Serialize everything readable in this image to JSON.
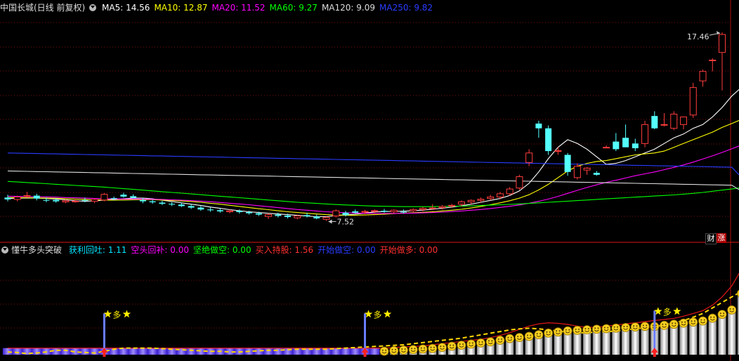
{
  "main_header": {
    "title": "中国长城(日线 前复权)",
    "ma": [
      {
        "label": "MA5: 14.56",
        "color": "#ffffff"
      },
      {
        "label": "MA10: 12.87",
        "color": "#ffff00"
      },
      {
        "label": "MA20: 11.52",
        "color": "#ff00ff"
      },
      {
        "label": "MA60: 9.27",
        "color": "#00ff00"
      },
      {
        "label": "MA120: 9.09",
        "color": "#dddddd"
      },
      {
        "label": "MA250: 9.82",
        "color": "#2a3cff"
      }
    ]
  },
  "badges": {
    "cai": "财",
    "zhang": "涨"
  },
  "indicator_header": {
    "title": "懂牛多头突破",
    "items": [
      {
        "label": "获利回吐: 1.11",
        "color": "#00e5ff"
      },
      {
        "label": "空头回补: 0.00",
        "color": "#ff00ff"
      },
      {
        "label": "坚绝做空: 0.00",
        "color": "#00ff00"
      },
      {
        "label": "买入持股: 1.56",
        "color": "#ff3030"
      },
      {
        "label": "开始做空: 0.00",
        "color": "#2a3cff"
      },
      {
        "label": "开始做多: 0.00",
        "color": "#ff3030"
      }
    ]
  },
  "chart_data": {
    "type": "candlestick",
    "price_ylim": [
      6.5,
      18.5
    ],
    "annotations": {
      "high": "17.46",
      "low": "7.52",
      "signal": "多"
    },
    "candles": [
      {
        "o": 8.75,
        "h": 8.9,
        "l": 8.55,
        "c": 8.65
      },
      {
        "o": 8.65,
        "h": 8.85,
        "l": 8.55,
        "c": 8.78
      },
      {
        "o": 8.85,
        "h": 9.05,
        "l": 8.75,
        "c": 8.85
      },
      {
        "o": 8.85,
        "h": 8.95,
        "l": 8.6,
        "c": 8.7
      },
      {
        "o": 8.62,
        "h": 8.75,
        "l": 8.5,
        "c": 8.6
      },
      {
        "o": 8.62,
        "h": 8.72,
        "l": 8.48,
        "c": 8.55
      },
      {
        "o": 8.52,
        "h": 8.65,
        "l": 8.45,
        "c": 8.58
      },
      {
        "o": 8.55,
        "h": 8.68,
        "l": 8.48,
        "c": 8.56
      },
      {
        "o": 8.62,
        "h": 8.75,
        "l": 8.5,
        "c": 8.6
      },
      {
        "o": 8.55,
        "h": 8.7,
        "l": 8.45,
        "c": 8.65
      },
      {
        "o": 8.62,
        "h": 8.98,
        "l": 8.55,
        "c": 8.92
      },
      {
        "o": 8.72,
        "h": 8.8,
        "l": 8.6,
        "c": 8.68
      },
      {
        "o": 8.9,
        "h": 9.0,
        "l": 8.75,
        "c": 8.8
      },
      {
        "o": 8.82,
        "h": 8.92,
        "l": 8.7,
        "c": 8.74
      },
      {
        "o": 8.62,
        "h": 8.72,
        "l": 8.45,
        "c": 8.55
      },
      {
        "o": 8.55,
        "h": 8.65,
        "l": 8.42,
        "c": 8.5
      },
      {
        "o": 8.48,
        "h": 8.58,
        "l": 8.35,
        "c": 8.42
      },
      {
        "o": 8.42,
        "h": 8.5,
        "l": 8.3,
        "c": 8.38
      },
      {
        "o": 8.38,
        "h": 8.48,
        "l": 8.25,
        "c": 8.3
      },
      {
        "o": 8.3,
        "h": 8.38,
        "l": 8.15,
        "c": 8.22
      },
      {
        "o": 8.22,
        "h": 8.3,
        "l": 8.05,
        "c": 8.12
      },
      {
        "o": 8.12,
        "h": 8.22,
        "l": 8.0,
        "c": 8.08
      },
      {
        "o": 8.08,
        "h": 8.18,
        "l": 7.95,
        "c": 8.02
      },
      {
        "o": 8.0,
        "h": 8.12,
        "l": 7.92,
        "c": 8.05
      },
      {
        "o": 8.05,
        "h": 8.12,
        "l": 7.9,
        "c": 7.98
      },
      {
        "o": 7.98,
        "h": 8.05,
        "l": 7.85,
        "c": 7.92
      },
      {
        "o": 7.92,
        "h": 8.0,
        "l": 7.78,
        "c": 7.85
      },
      {
        "o": 7.75,
        "h": 7.92,
        "l": 7.62,
        "c": 7.85
      },
      {
        "o": 7.85,
        "h": 7.95,
        "l": 7.7,
        "c": 7.78
      },
      {
        "o": 7.8,
        "h": 7.9,
        "l": 7.65,
        "c": 7.72
      },
      {
        "o": 7.68,
        "h": 7.85,
        "l": 7.6,
        "c": 7.78
      },
      {
        "o": 7.82,
        "h": 7.95,
        "l": 7.7,
        "c": 7.76
      },
      {
        "o": 7.75,
        "h": 7.85,
        "l": 7.6,
        "c": 7.65
      },
      {
        "o": 7.6,
        "h": 7.75,
        "l": 7.52,
        "c": 7.7
      },
      {
        "o": 7.78,
        "h": 8.12,
        "l": 7.7,
        "c": 8.05
      },
      {
        "o": 7.95,
        "h": 8.05,
        "l": 7.75,
        "c": 7.82
      },
      {
        "o": 8.02,
        "h": 8.12,
        "l": 7.9,
        "c": 7.95
      },
      {
        "o": 7.98,
        "h": 8.1,
        "l": 7.88,
        "c": 8.02
      },
      {
        "o": 8.02,
        "h": 8.12,
        "l": 7.92,
        "c": 8.06
      },
      {
        "o": 8.05,
        "h": 8.15,
        "l": 7.95,
        "c": 8.0
      },
      {
        "o": 8.0,
        "h": 8.12,
        "l": 7.92,
        "c": 8.08
      },
      {
        "o": 8.0,
        "h": 8.12,
        "l": 7.9,
        "c": 7.96
      },
      {
        "o": 8.05,
        "h": 8.18,
        "l": 7.98,
        "c": 8.12
      },
      {
        "o": 8.12,
        "h": 8.25,
        "l": 8.02,
        "c": 8.18
      },
      {
        "o": 8.2,
        "h": 8.4,
        "l": 8.12,
        "c": 8.2
      },
      {
        "o": 8.22,
        "h": 8.35,
        "l": 8.12,
        "c": 8.28
      },
      {
        "o": 8.3,
        "h": 8.42,
        "l": 8.2,
        "c": 8.34
      },
      {
        "o": 8.4,
        "h": 8.6,
        "l": 8.28,
        "c": 8.52
      },
      {
        "o": 8.52,
        "h": 8.65,
        "l": 8.4,
        "c": 8.6
      },
      {
        "o": 8.6,
        "h": 8.75,
        "l": 8.5,
        "c": 8.66
      },
      {
        "o": 8.7,
        "h": 8.9,
        "l": 8.6,
        "c": 8.78
      },
      {
        "o": 8.78,
        "h": 9.05,
        "l": 8.65,
        "c": 8.95
      },
      {
        "o": 8.95,
        "h": 9.3,
        "l": 8.85,
        "c": 9.2
      },
      {
        "o": 9.25,
        "h": 9.95,
        "l": 9.15,
        "c": 9.85
      },
      {
        "o": 10.6,
        "h": 11.3,
        "l": 10.4,
        "c": 11.1
      },
      {
        "o": 12.65,
        "h": 12.8,
        "l": 11.9,
        "c": 12.4
      },
      {
        "o": 12.4,
        "h": 12.55,
        "l": 11.0,
        "c": 11.2
      },
      {
        "o": 11.2,
        "h": 11.4,
        "l": 11.0,
        "c": 11.22
      },
      {
        "o": 11.0,
        "h": 11.1,
        "l": 9.9,
        "c": 10.1
      },
      {
        "o": 9.8,
        "h": 10.55,
        "l": 9.7,
        "c": 10.4
      },
      {
        "o": 10.2,
        "h": 10.35,
        "l": 9.95,
        "c": 10.3
      },
      {
        "o": 10.05,
        "h": 10.15,
        "l": 9.9,
        "c": 9.95
      },
      {
        "o": 11.4,
        "h": 11.5,
        "l": 11.35,
        "c": 11.4
      },
      {
        "o": 11.7,
        "h": 12.15,
        "l": 11.2,
        "c": 11.3
      },
      {
        "o": 11.9,
        "h": 12.6,
        "l": 11.4,
        "c": 11.4
      },
      {
        "o": 11.6,
        "h": 11.85,
        "l": 11.2,
        "c": 11.35
      },
      {
        "o": 11.6,
        "h": 12.8,
        "l": 11.4,
        "c": 12.6
      },
      {
        "o": 13.05,
        "h": 13.3,
        "l": 12.35,
        "c": 12.4
      },
      {
        "o": 12.6,
        "h": 13.2,
        "l": 12.5,
        "c": 12.6
      },
      {
        "o": 12.4,
        "h": 13.3,
        "l": 12.3,
        "c": 13.15
      },
      {
        "o": 12.6,
        "h": 13.0,
        "l": 12.35,
        "c": 13.0
      },
      {
        "o": 13.1,
        "h": 14.8,
        "l": 12.95,
        "c": 14.55
      },
      {
        "o": 14.9,
        "h": 15.5,
        "l": 14.6,
        "c": 15.4
      },
      {
        "o": 16.0,
        "h": 16.1,
        "l": 15.4,
        "c": 16.0
      },
      {
        "o": 16.4,
        "h": 17.46,
        "l": 14.4,
        "c": 17.35
      }
    ],
    "ma_lines": [
      {
        "name": "MA5",
        "color": "#ffffff",
        "values": [
          8.7,
          8.72,
          8.73,
          8.72,
          8.7,
          8.67,
          8.63,
          8.58,
          8.55,
          8.57,
          8.62,
          8.65,
          8.68,
          8.72,
          8.72,
          8.68,
          8.61,
          8.54,
          8.47,
          8.4,
          8.33,
          8.25,
          8.18,
          8.11,
          8.05,
          8.0,
          7.96,
          7.92,
          7.88,
          7.85,
          7.81,
          7.77,
          7.74,
          7.74,
          7.8,
          7.83,
          7.87,
          7.93,
          7.99,
          8.01,
          8.02,
          8.03,
          8.05,
          8.09,
          8.13,
          8.19,
          8.24,
          8.32,
          8.4,
          8.5,
          8.6,
          8.7,
          8.86,
          9.1,
          9.5,
          10.1,
          10.8,
          11.4,
          11.8,
          11.6,
          11.3,
          10.9,
          10.5,
          10.55,
          10.7,
          10.9,
          11.1,
          11.3,
          11.6,
          11.9,
          12.1,
          12.4,
          12.6,
          13.0,
          13.5,
          14.1,
          14.56
        ]
      },
      {
        "name": "MA10",
        "color": "#ffff00",
        "values": [
          8.75,
          8.75,
          8.74,
          8.73,
          8.72,
          8.71,
          8.69,
          8.67,
          8.65,
          8.63,
          8.62,
          8.61,
          8.62,
          8.63,
          8.64,
          8.64,
          8.62,
          8.6,
          8.57,
          8.54,
          8.5,
          8.45,
          8.4,
          8.34,
          8.28,
          8.22,
          8.16,
          8.11,
          8.05,
          8.0,
          7.96,
          7.92,
          7.88,
          7.85,
          7.83,
          7.82,
          7.82,
          7.83,
          7.85,
          7.87,
          7.9,
          7.93,
          7.95,
          7.97,
          8.0,
          8.04,
          8.08,
          8.13,
          8.2,
          8.28,
          8.37,
          8.47,
          8.58,
          8.72,
          8.9,
          9.15,
          9.45,
          9.8,
          10.15,
          10.4,
          10.55,
          10.65,
          10.7,
          10.8,
          10.9,
          11.0,
          11.05,
          11.1,
          11.2,
          11.4,
          11.6,
          11.8,
          12.0,
          12.2,
          12.45,
          12.65,
          12.87
        ]
      },
      {
        "name": "MA20",
        "color": "#ff00ff",
        "values": [
          8.82,
          8.81,
          8.8,
          8.79,
          8.78,
          8.77,
          8.75,
          8.74,
          8.72,
          8.7,
          8.69,
          8.68,
          8.67,
          8.67,
          8.67,
          8.66,
          8.65,
          8.63,
          8.61,
          8.59,
          8.56,
          8.53,
          8.49,
          8.45,
          8.41,
          8.37,
          8.32,
          8.27,
          8.22,
          8.17,
          8.12,
          8.08,
          8.04,
          8.0,
          7.97,
          7.95,
          7.93,
          7.92,
          7.91,
          7.91,
          7.91,
          7.92,
          7.93,
          7.94,
          7.96,
          7.98,
          8.01,
          8.04,
          8.08,
          8.12,
          8.17,
          8.23,
          8.29,
          8.36,
          8.45,
          8.55,
          8.67,
          8.81,
          8.97,
          9.13,
          9.28,
          9.42,
          9.55,
          9.66,
          9.78,
          9.9,
          10.0,
          10.1,
          10.22,
          10.34,
          10.47,
          10.62,
          10.78,
          10.95,
          11.13,
          11.32,
          11.52
        ]
      },
      {
        "name": "MA60",
        "color": "#00ff00",
        "values": [
          9.6,
          9.57,
          9.54,
          9.51,
          9.48,
          9.45,
          9.42,
          9.39,
          9.36,
          9.33,
          9.3,
          9.26,
          9.22,
          9.18,
          9.14,
          9.1,
          9.06,
          9.02,
          8.98,
          8.94,
          8.9,
          8.86,
          8.82,
          8.78,
          8.74,
          8.7,
          8.66,
          8.62,
          8.58,
          8.54,
          8.5,
          8.47,
          8.44,
          8.41,
          8.38,
          8.36,
          8.34,
          8.32,
          8.3,
          8.29,
          8.28,
          8.27,
          8.27,
          8.27,
          8.27,
          8.28,
          8.29,
          8.3,
          8.31,
          8.33,
          8.35,
          8.37,
          8.39,
          8.41,
          8.44,
          8.47,
          8.5,
          8.53,
          8.56,
          8.59,
          8.62,
          8.65,
          8.68,
          8.71,
          8.74,
          8.77,
          8.8,
          8.83,
          8.86,
          8.89,
          8.93,
          8.97,
          9.02,
          9.08,
          9.14,
          9.2,
          9.27
        ]
      },
      {
        "name": "MA120",
        "color": "#dddddd",
        "values": [
          10.15,
          10.14,
          10.13,
          10.12,
          10.11,
          10.1,
          10.09,
          10.08,
          10.07,
          10.06,
          10.05,
          10.04,
          10.03,
          10.02,
          10.01,
          10.0,
          9.99,
          9.98,
          9.97,
          9.96,
          9.95,
          9.94,
          9.93,
          9.92,
          9.91,
          9.9,
          9.89,
          9.88,
          9.87,
          9.86,
          9.85,
          9.84,
          9.83,
          9.82,
          9.81,
          9.8,
          9.79,
          9.78,
          9.77,
          9.76,
          9.75,
          9.74,
          9.73,
          9.72,
          9.71,
          9.7,
          9.69,
          9.68,
          9.67,
          9.66,
          9.65,
          9.64,
          9.63,
          9.62,
          9.61,
          9.6,
          9.59,
          9.58,
          9.57,
          9.56,
          9.55,
          9.54,
          9.53,
          9.52,
          9.51,
          9.5,
          9.49,
          9.48,
          9.47,
          9.46,
          9.45,
          9.44,
          9.43,
          9.42,
          9.41,
          9.4,
          9.09
        ]
      },
      {
        "name": "MA250",
        "color": "#2a3cff",
        "values": [
          11.1,
          11.09,
          11.08,
          11.07,
          11.06,
          11.05,
          11.04,
          11.03,
          11.02,
          11.01,
          11.0,
          10.99,
          10.98,
          10.97,
          10.96,
          10.95,
          10.94,
          10.93,
          10.92,
          10.91,
          10.9,
          10.89,
          10.88,
          10.87,
          10.86,
          10.85,
          10.84,
          10.83,
          10.82,
          10.81,
          10.8,
          10.79,
          10.78,
          10.77,
          10.76,
          10.75,
          10.74,
          10.73,
          10.72,
          10.71,
          10.7,
          10.69,
          10.68,
          10.67,
          10.66,
          10.65,
          10.64,
          10.63,
          10.62,
          10.61,
          10.6,
          10.59,
          10.58,
          10.57,
          10.56,
          10.55,
          10.54,
          10.53,
          10.52,
          10.51,
          10.5,
          10.49,
          10.48,
          10.47,
          10.46,
          10.45,
          10.44,
          10.43,
          10.42,
          10.41,
          10.4,
          10.39,
          10.38,
          10.37,
          10.36,
          10.35,
          9.82
        ]
      }
    ],
    "indicator": {
      "ylim": [
        0,
        1.8
      ],
      "smiley_start_index": 39,
      "bars": [
        0.12,
        0.12,
        0.12,
        0.12,
        0.12,
        0.12,
        0.12,
        0.12,
        0.12,
        0.12,
        0.12,
        0.12,
        0.12,
        0.12,
        0.12,
        0.12,
        0.12,
        0.12,
        0.12,
        0.12,
        0.12,
        0.12,
        0.12,
        0.12,
        0.12,
        0.12,
        0.12,
        0.12,
        0.12,
        0.12,
        0.12,
        0.12,
        0.12,
        0.12,
        0.12,
        0.12,
        0.12,
        0.12,
        0.12,
        0.05,
        0.06,
        0.07,
        0.08,
        0.09,
        0.1,
        0.12,
        0.14,
        0.16,
        0.18,
        0.2,
        0.22,
        0.25,
        0.28,
        0.3,
        0.32,
        0.35,
        0.38,
        0.4,
        0.42,
        0.43,
        0.44,
        0.45,
        0.46,
        0.47,
        0.48,
        0.49,
        0.5,
        0.5,
        0.52,
        0.54,
        0.56,
        0.58,
        0.6,
        0.65,
        0.72,
        0.8,
        1.1
      ],
      "red_line": [
        0.12,
        0.12,
        0.12,
        0.12,
        0.12,
        0.12,
        0.12,
        0.12,
        0.12,
        0.12,
        0.12,
        0.12,
        0.12,
        0.12,
        0.12,
        0.12,
        0.12,
        0.12,
        0.12,
        0.12,
        0.12,
        0.12,
        0.12,
        0.12,
        0.12,
        0.12,
        0.12,
        0.12,
        0.12,
        0.12,
        0.12,
        0.12,
        0.12,
        0.12,
        0.12,
        0.12,
        0.12,
        0.12,
        0.12,
        0.12,
        0.13,
        0.14,
        0.15,
        0.16,
        0.18,
        0.2,
        0.22,
        0.24,
        0.26,
        0.28,
        0.31,
        0.35,
        0.4,
        0.46,
        0.52,
        0.56,
        0.58,
        0.57,
        0.55,
        0.52,
        0.5,
        0.5,
        0.52,
        0.54,
        0.56,
        0.58,
        0.6,
        0.62,
        0.64,
        0.66,
        0.7,
        0.75,
        0.8,
        0.9,
        1.05,
        1.25,
        1.55
      ],
      "yellow_line": [
        0.05,
        0.04,
        0.02,
        0.03,
        0.05,
        0.08,
        0.08,
        0.05,
        0.04,
        0.03,
        0.06,
        0.1,
        0.12,
        0.12,
        0.12,
        0.12,
        0.11,
        0.1,
        0.09,
        0.08,
        0.07,
        0.06,
        0.06,
        0.05,
        0.05,
        0.06,
        0.07,
        0.08,
        0.08,
        0.09,
        0.1,
        0.1,
        0.1,
        0.1,
        0.11,
        0.12,
        0.13,
        0.14,
        0.15,
        0.16,
        0.17,
        0.18,
        0.2,
        0.22,
        0.24,
        0.26,
        0.28,
        0.3,
        0.33,
        0.36,
        0.39,
        0.42,
        0.45,
        0.47,
        0.48,
        0.47,
        0.45,
        0.43,
        0.41,
        0.4,
        0.4,
        0.41,
        0.42,
        0.43,
        0.45,
        0.47,
        0.49,
        0.51,
        0.54,
        0.58,
        0.62,
        0.68,
        0.75,
        0.85,
        0.95,
        1.05,
        1.15
      ],
      "signals": [
        {
          "index": 10,
          "height": 0.75
        },
        {
          "index": 37,
          "height": 0.75
        },
        {
          "index": 67,
          "height": 0.8
        }
      ]
    }
  }
}
